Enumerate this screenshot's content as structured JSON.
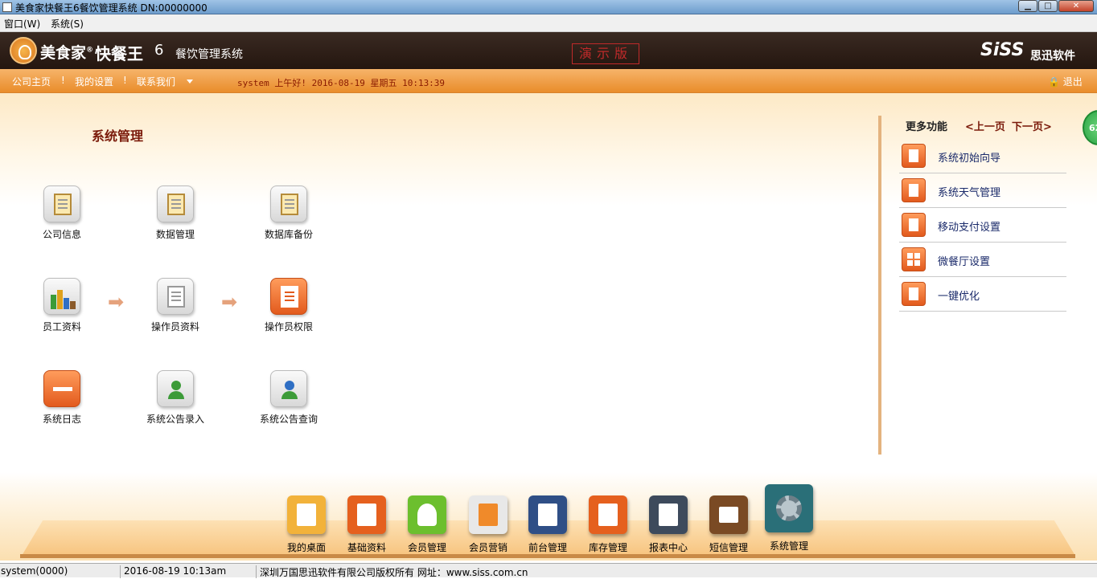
{
  "window": {
    "title": "美食家快餐王6餐饮管理系统 DN:00000000",
    "min": "▁",
    "max": "□",
    "close": "✕"
  },
  "menubar": {
    "items": [
      "窗口(W)",
      "系统(S)"
    ]
  },
  "header": {
    "brand": "美食家",
    "brand_mark": "®",
    "product": "快餐王",
    "version": "6",
    "subtitle": "餐饮管理系统",
    "demo": "演示版",
    "vendor_logo": "SiSS",
    "vendor_name": "思迅软件"
  },
  "nav": {
    "home": "公司主页",
    "settings": "我的设置",
    "contact": "联系我们",
    "sep": "!",
    "greeting": "system 上午好! 2016-08-19 星期五 10:13:39",
    "logout": "退出"
  },
  "main": {
    "title": "系统管理",
    "functions": [
      {
        "label": "公司信息",
        "icon": "clipboard-icon"
      },
      {
        "label": "数据管理",
        "icon": "data-file-icon"
      },
      {
        "label": "数据库备份",
        "icon": "database-backup-icon"
      },
      {
        "label": "员工资料",
        "icon": "staff-chart-icon"
      },
      {
        "label": "操作员资料",
        "icon": "operator-desk-icon"
      },
      {
        "label": "操作员权限",
        "icon": "permission-doc-icon"
      },
      {
        "label": "系统日志",
        "icon": "log-minus-icon"
      },
      {
        "label": "系统公告录入",
        "icon": "notice-entry-icon"
      },
      {
        "label": "系统公告查询",
        "icon": "notice-query-icon"
      }
    ],
    "arrow": "➡"
  },
  "side": {
    "title": "更多功能",
    "prev": "<上一页",
    "next": "下一页>",
    "items": [
      {
        "label": "系统初始向导"
      },
      {
        "label": "系统天气管理"
      },
      {
        "label": "移动支付设置"
      },
      {
        "label": "微餐厅设置"
      },
      {
        "label": "一键优化"
      }
    ]
  },
  "bubble": "62",
  "dock": {
    "items": [
      {
        "label": "我的桌面",
        "color": "#f2b23a"
      },
      {
        "label": "基础资料",
        "color": "#e5601e"
      },
      {
        "label": "会员管理",
        "color": "#6cbf2e"
      },
      {
        "label": "会员营销",
        "color": "#e8e8e8"
      },
      {
        "label": "前台管理",
        "color": "#2f4f86"
      },
      {
        "label": "库存管理",
        "color": "#e5601e"
      },
      {
        "label": "报表中心",
        "color": "#3d4a5c"
      },
      {
        "label": "短信管理",
        "color": "#7a4a24"
      },
      {
        "label": "系统管理",
        "color": "#2a6f78"
      }
    ]
  },
  "status": {
    "user": "system(0000)",
    "time": "2016-08-19 10:13am",
    "copyright": "深圳万国思迅软件有限公司版权所有 网址：www.siss.com.cn"
  }
}
